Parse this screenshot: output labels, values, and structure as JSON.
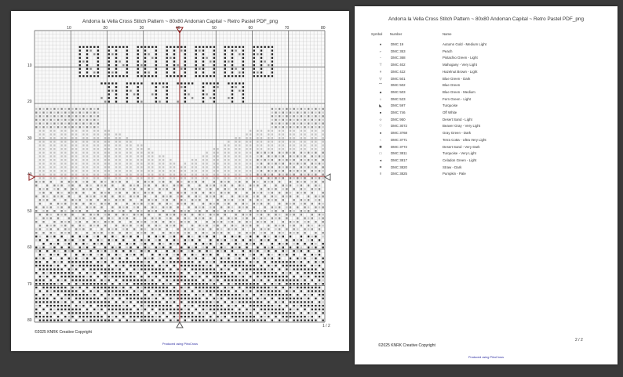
{
  "page1": {
    "title": "Andorra la Vella Cross Stitch Pattern ~ 80x80 Andorran Capital ~ Retro Pastel PDF_png",
    "top_ticks": [
      "10",
      "20",
      "30",
      "40",
      "50",
      "60",
      "70",
      "80"
    ],
    "left_ticks": [
      "10",
      "20",
      "30",
      "40",
      "50",
      "60",
      "70",
      "80"
    ],
    "copyright": "©2025 KNRK Creative Copyright",
    "produced_by": "Produced using PiiroCross",
    "page_number": "1 / 2"
  },
  "page2": {
    "title": "Andorra la Vella Cross Stitch Pattern ~ 80x80 Andorran Capital ~ Retro Pastel PDF_png",
    "headers": {
      "symbol": "Symbol",
      "number": "Number",
      "name": "Name"
    },
    "legend": [
      {
        "symbol": "♦",
        "number": "DMC 19",
        "name": "Autumn Gold - Medium Light"
      },
      {
        "symbol": "⌐",
        "number": "DMC 353",
        "name": "Peach"
      },
      {
        "symbol": "-",
        "number": "DMC 368",
        "name": "Pistachio Green - Light"
      },
      {
        "symbol": "⊤",
        "number": "DMC 402",
        "name": "Mahogany - Very Light"
      },
      {
        "symbol": "×",
        "number": "DMC 422",
        "name": "Hazelnut Brown - Light"
      },
      {
        "symbol": "▽",
        "number": "DMC 501",
        "name": "Blue Green - Dark"
      },
      {
        "symbol": "⌒",
        "number": "DMC 502",
        "name": "Blue Green"
      },
      {
        "symbol": "▲",
        "number": "DMC 503",
        "name": "Blue Green - Medium"
      },
      {
        "symbol": "○",
        "number": "DMC 523",
        "name": "Fern Green - Light"
      },
      {
        "symbol": "◣",
        "number": "DMC 597",
        "name": "Turquoise"
      },
      {
        "symbol": "●",
        "number": "DMC 746",
        "name": "Off White"
      },
      {
        "symbol": "☆",
        "number": "DMC 950",
        "name": "Desert Sand - Light"
      },
      {
        "symbol": "♡",
        "number": "DMC 3072",
        "name": "Beaver Gray - Very Light"
      },
      {
        "symbol": "♠",
        "number": "DMC 3768",
        "name": "Gray Green - Dark"
      },
      {
        "symbol": "‹",
        "number": "DMC 3771",
        "name": "Terra Cotta - Ultra Very Light"
      },
      {
        "symbol": "✱",
        "number": "DMC 3772",
        "name": "Desert Sand - Very Dark"
      },
      {
        "symbol": "□",
        "number": "DMC 3811",
        "name": "Turquoise - Very Light"
      },
      {
        "symbol": "◂",
        "number": "DMC 3817",
        "name": "Celadon Green - Light"
      },
      {
        "symbol": "⌗",
        "number": "DMC 3820",
        "name": "Straw - Dark"
      },
      {
        "symbol": "◊",
        "number": "DMC 3825",
        "name": "Pumpkin - Pale"
      }
    ],
    "copyright": "©2025 KNRK Creative Copyright",
    "produced_by": "Produced using PiiroCross",
    "page_number": "2 / 2"
  },
  "colors": {
    "background": "#3a3a3a",
    "page": "#ffffff",
    "grid_line": "#bbbbbb",
    "grid_major": "#555555",
    "center_line": "#8b1a1a",
    "symbol_dark": "#222222",
    "symbol_mid": "#888888",
    "symbol_light": "#c0c0c0"
  },
  "icons": {
    "center_marker_top": "down-triangle-marker",
    "center_marker_bottom": "up-triangle-marker",
    "center_marker_left": "right-triangle-marker",
    "center_marker_right": "left-triangle-marker"
  }
}
